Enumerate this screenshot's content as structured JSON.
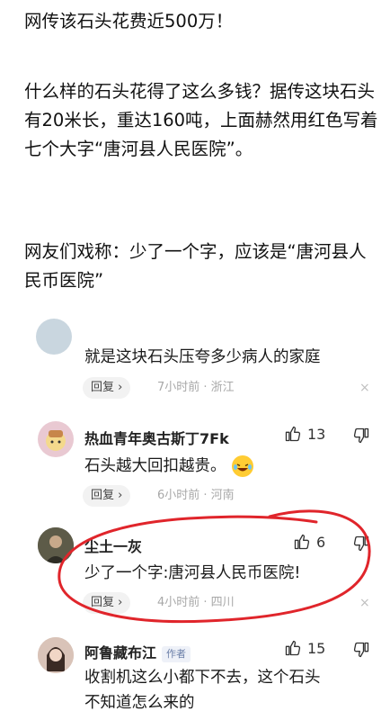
{
  "article": {
    "p1": "网传该石头花费近500万！",
    "p2": "什么样的石头花得了这么多钱？据传这块石头有20米长，重达160吨，上面赫然用红色写着七个大字“唐河县人民医院”。",
    "p3": "网友们戏称：少了一个字，应该是“唐河县人民币医院”"
  },
  "comments": [
    {
      "text": "就是这块石头压夸多少病人的家庭",
      "reply_label": "回复 ›",
      "meta": "7小时前 · 浙江",
      "close": "×"
    },
    {
      "name": "热血青年奥古斯丁7Fk",
      "likes": "13",
      "text": "石头越大回扣越贵。",
      "reply_label": "回复 ›",
      "meta": "6小时前 · 河南"
    },
    {
      "name": "尘土一灰",
      "likes": "6",
      "text": "少了一个字:唐河县人民币医院!",
      "reply_label": "回复 ›",
      "meta": "4小时前 · 四川",
      "close": "×"
    },
    {
      "name": "阿鲁藏布江",
      "tag": "作者",
      "likes": "15",
      "text_line1": "收割机这么小都下不去，这个石头",
      "text_line2": "不知道怎么来的"
    }
  ],
  "icons": {
    "like": "thumbs-up-icon",
    "dislike": "thumbs-down-icon",
    "emoji": "laughing-emoji-icon",
    "annotation": "red-hand-drawn-circle"
  },
  "colors": {
    "annotation": "#e0252b",
    "meta": "#a8a8a8",
    "reply_bg": "#f2f2f2"
  }
}
